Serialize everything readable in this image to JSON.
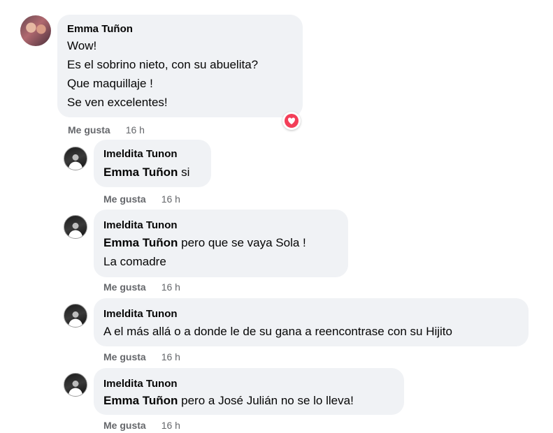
{
  "comments": [
    {
      "author": "Emma Tuñon",
      "lines": [
        "Wow!",
        "Es el sobrino nieto, con su abuelita?",
        "Que maquillaje !",
        "Se ven excelentes!"
      ],
      "like_label": "Me gusta",
      "time": "16 h",
      "reaction": "love-icon"
    }
  ],
  "replies": [
    {
      "author": "Imeldita Tunon",
      "mention": "Emma Tuñon",
      "text": " si",
      "like_label": "Me gusta",
      "time": "16 h"
    },
    {
      "author": "Imeldita Tunon",
      "mention": "Emma Tuñon",
      "text": " pero que se vaya Sola !",
      "text2": "La comadre",
      "like_label": "Me gusta",
      "time": "16 h"
    },
    {
      "author": "Imeldita Tunon",
      "text": "A el más allá o a donde le de su gana a reencontrase con su Hijito",
      "like_label": "Me gusta",
      "time": "16 h"
    },
    {
      "author": "Imeldita Tunon",
      "mention": "Emma Tuñon",
      "text": " pero a José Julián no se lo lleva!",
      "like_label": "Me gusta",
      "time": "16 h"
    }
  ],
  "colors": {
    "bubble": "#f0f2f5",
    "meta_text": "#65676b",
    "love": "#f33e58"
  }
}
